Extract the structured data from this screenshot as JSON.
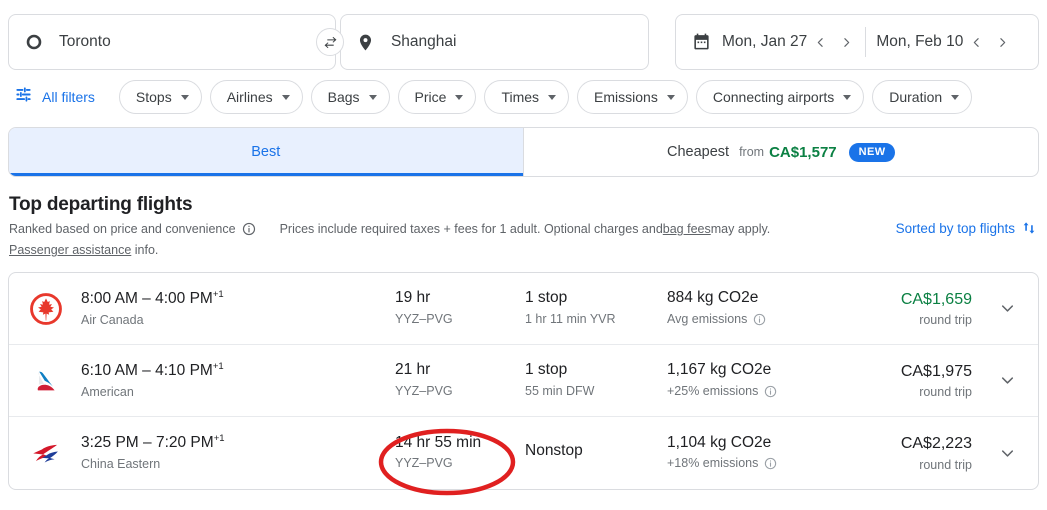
{
  "search": {
    "origin": {
      "value": "Toronto",
      "icon": "circle-origin-icon"
    },
    "destination": {
      "value": "Shanghai",
      "icon": "place-pin-icon"
    },
    "swap_label": "swap-icon",
    "depart_date": "Mon, Jan 27",
    "return_date": "Mon, Feb 10"
  },
  "filters": {
    "all_filters_label": "All filters",
    "chips": [
      {
        "label": "Stops"
      },
      {
        "label": "Airlines"
      },
      {
        "label": "Bags"
      },
      {
        "label": "Price"
      },
      {
        "label": "Times"
      },
      {
        "label": "Emissions"
      },
      {
        "label": "Connecting airports"
      },
      {
        "label": "Duration"
      }
    ]
  },
  "tabs": {
    "best": {
      "label": "Best",
      "active": true
    },
    "cheapest": {
      "label": "Cheapest",
      "from_label": "from",
      "price": "CA$1,577",
      "badge": "NEW"
    }
  },
  "results_header": {
    "title": "Top departing flights",
    "ranked_note": "Ranked based on price and convenience",
    "prices_note_a": "Prices include required taxes + fees for 1 adult. Optional charges and ",
    "bag_fees_link": "bag fees",
    "prices_note_b": " may apply.",
    "assistance_link": "Passenger assistance",
    "assistance_tail": " info.",
    "sorted_label": "Sorted by top flights"
  },
  "flights": [
    {
      "airline": "Air Canada",
      "logo": "air-canada-logo",
      "times": "8:00 AM – 4:00 PM",
      "day_offset": "+1",
      "duration": "19 hr",
      "route": "YYZ–PVG",
      "stops": "1 stop",
      "stop_detail": "1 hr 11 min YVR",
      "emissions": "884 kg CO2e",
      "emissions_note": "Avg emissions",
      "price": "CA$1,659",
      "price_color": "green",
      "price_note": "round trip"
    },
    {
      "airline": "American",
      "logo": "american-airlines-logo",
      "times": "6:10 AM – 4:10 PM",
      "day_offset": "+1",
      "duration": "21 hr",
      "route": "YYZ–PVG",
      "stops": "1 stop",
      "stop_detail": "55 min DFW",
      "emissions": "1,167 kg CO2e",
      "emissions_note": "+25% emissions",
      "price": "CA$1,975",
      "price_color": "dark",
      "price_note": "round trip"
    },
    {
      "airline": "China Eastern",
      "logo": "china-eastern-logo",
      "times": "3:25 PM – 7:20 PM",
      "day_offset": "+1",
      "duration": "14 hr 55 min",
      "route": "YYZ–PVG",
      "stops": "Nonstop",
      "stop_detail": "",
      "emissions": "1,104 kg CO2e",
      "emissions_note": "+18% emissions",
      "price": "CA$2,223",
      "price_color": "dark",
      "price_note": "round trip"
    }
  ],
  "annotation": {
    "shape": "ellipse",
    "color": "#e02020",
    "target": "14 hr 55 min YYZ–PVG"
  },
  "colors": {
    "accent_blue": "#1a73e8",
    "price_green": "#0b8043",
    "tab_active_bg": "#e8f0fe",
    "border": "#dadce0",
    "text_primary": "#202124",
    "text_secondary": "#70757a",
    "annotation_red": "#e02020"
  }
}
